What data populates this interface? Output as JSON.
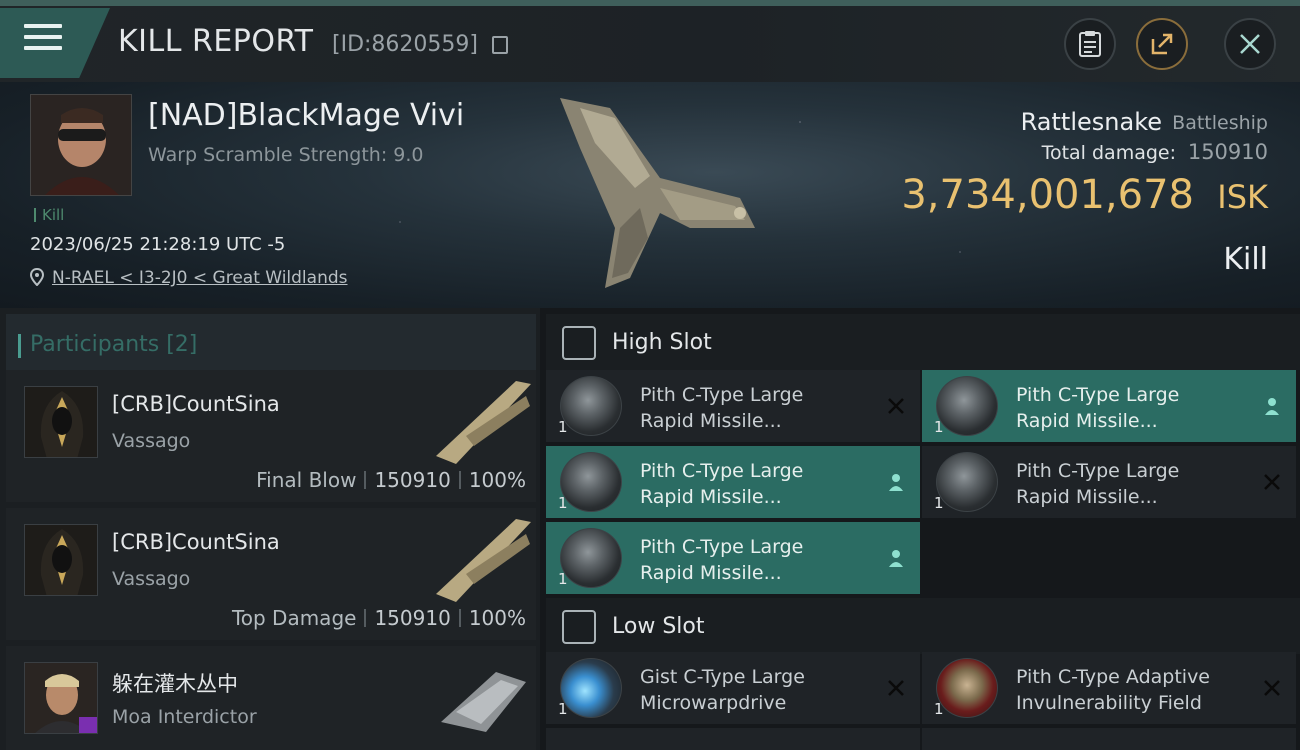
{
  "header": {
    "title": "KILL REPORT",
    "report_id": "[ID:8620559]",
    "icons": {
      "menu": "hamburger-menu-icon",
      "copy": "copy-icon",
      "clipboard": "clipboard-icon",
      "share": "share-icon",
      "close": "close-icon"
    }
  },
  "victim": {
    "name": "[NAD]BlackMage Vivi",
    "warp_scramble": "Warp Scramble Strength: 9.0",
    "tag": "Kill",
    "datetime": "2023/06/25 21:28:19 UTC -5",
    "location": "N-RAEL < I3-2J0 < Great Wildlands",
    "ship_name": "Rattlesnake",
    "ship_class": "Battleship",
    "total_damage_label": "Total damage:",
    "total_damage": "150910",
    "isk_value": "3,734,001,678",
    "isk_unit": "ISK",
    "result": "Kill"
  },
  "participants": {
    "title": "Participants [2]",
    "items": [
      {
        "name": "[CRB]CountSina",
        "ship": "Vassago",
        "role": "Final Blow",
        "damage": "150910",
        "percent": "100%"
      },
      {
        "name": "[CRB]CountSina",
        "ship": "Vassago",
        "role": "Top Damage",
        "damage": "150910",
        "percent": "100%"
      },
      {
        "name": "躲在灌木丛中",
        "ship": "Moa Interdictor"
      }
    ]
  },
  "fittings": {
    "high_slot": {
      "title": "High Slot",
      "modules": [
        {
          "line1": "Pith C-Type Large",
          "line2": "Rapid Missile...",
          "qty": "1",
          "status": "destroyed"
        },
        {
          "line1": "Pith C-Type Large",
          "line2": "Rapid Missile...",
          "qty": "1",
          "status": "dropped"
        },
        {
          "line1": "Pith C-Type Large",
          "line2": "Rapid Missile...",
          "qty": "1",
          "status": "dropped"
        },
        {
          "line1": "Pith C-Type Large",
          "line2": "Rapid Missile...",
          "qty": "1",
          "status": "destroyed"
        },
        {
          "line1": "Pith C-Type Large",
          "line2": "Rapid Missile...",
          "qty": "1",
          "status": "dropped"
        }
      ]
    },
    "low_slot": {
      "title": "Low Slot",
      "modules": [
        {
          "line1": "Gist C-Type Large",
          "line2": "Microwarpdrive",
          "qty": "1",
          "status": "destroyed"
        },
        {
          "line1": "Pith C-Type Adaptive",
          "line2": "Invulnerability Field",
          "qty": "1",
          "status": "destroyed"
        }
      ]
    }
  },
  "colors": {
    "accent": "#2b6c63",
    "isk": "#e9c170",
    "background": "#15181b"
  }
}
